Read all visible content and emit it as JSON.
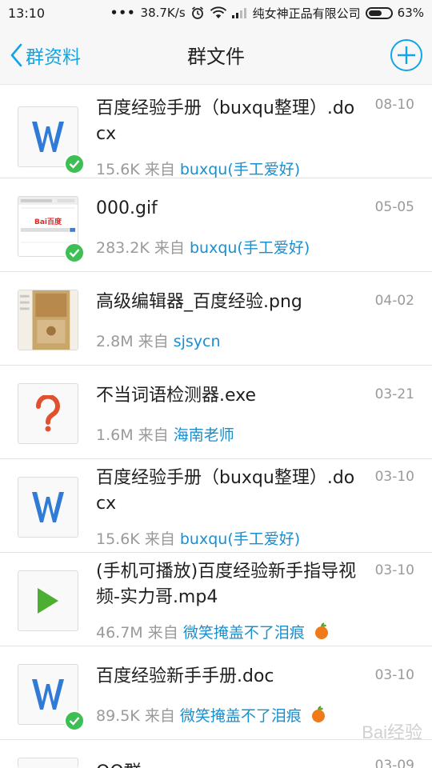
{
  "status_bar": {
    "time": "13:10",
    "dots": "•••",
    "speed": "38.7K/s",
    "carrier": "纯女神正品有限公司",
    "battery": "63%",
    "battery_level": 0.63
  },
  "header": {
    "back_label": "群资料",
    "title": "群文件",
    "add_icon": "plus-circle-icon"
  },
  "colors": {
    "accent": "#12a5e6",
    "user_link": "#1a8fd0",
    "check_green": "#3dbf54",
    "word_blue": "#2f7bd6",
    "play_green": "#4caf32",
    "question_red": "#e0522f"
  },
  "files": [
    {
      "name": "百度经验手册（buxqu整理）.docx",
      "date": "08-10",
      "size": "15.6K",
      "from_label": "来自",
      "user": "buxqu(手工爱好)",
      "icon": "word-doc-icon",
      "downloaded": true,
      "apple": false
    },
    {
      "name": "000.gif",
      "date": "05-05",
      "size": "283.2K",
      "from_label": "来自",
      "user": "buxqu(手工爱好)",
      "icon": "image-thumbnail",
      "thumb_text": "Bai百度",
      "downloaded": true,
      "apple": false
    },
    {
      "name": "高级编辑器_百度经验.png",
      "date": "04-02",
      "size": "2.8M",
      "from_label": "来自",
      "user": "sjsycn",
      "icon": "image-thumbnail",
      "downloaded": false,
      "apple": false
    },
    {
      "name": "不当词语检测器.exe",
      "date": "03-21",
      "size": "1.6M",
      "from_label": "来自",
      "user": "海南老师",
      "icon": "question-mark-icon",
      "downloaded": false,
      "apple": false
    },
    {
      "name": "百度经验手册（buxqu整理）.docx",
      "date": "03-10",
      "size": "15.6K",
      "from_label": "来自",
      "user": "buxqu(手工爱好)",
      "icon": "word-doc-icon",
      "downloaded": false,
      "apple": false
    },
    {
      "name": "(手机可播放)百度经验新手指导视频-实力哥.mp4",
      "date": "03-10",
      "size": "46.7M",
      "from_label": "来自",
      "user": "微笑掩盖不了泪痕",
      "icon": "video-play-icon",
      "downloaded": false,
      "apple": true
    },
    {
      "name": "百度经验新手手册.doc",
      "date": "03-10",
      "size": "89.5K",
      "from_label": "来自",
      "user": "微笑掩盖不了泪痕",
      "icon": "word-doc-icon",
      "downloaded": true,
      "apple": true
    }
  ],
  "partial_row": {
    "name": "QQ群…",
    "date": "03-09"
  },
  "watermark": "Bai经验"
}
